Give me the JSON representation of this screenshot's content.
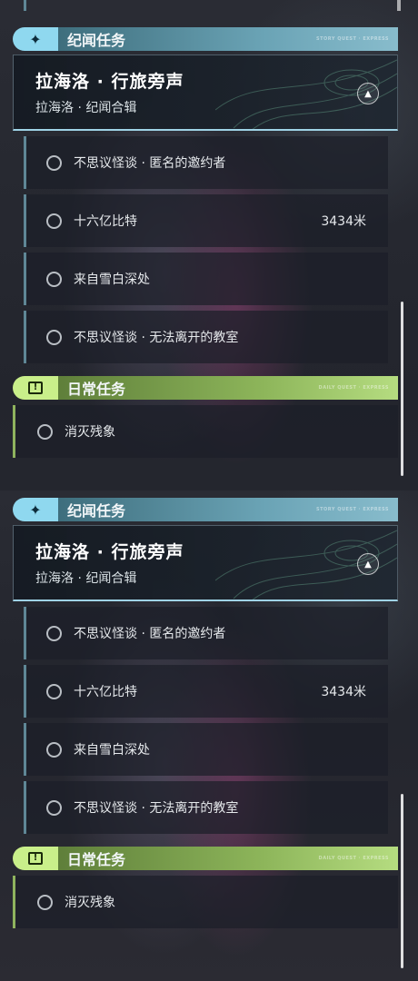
{
  "story_category": {
    "label": "纪闻任务",
    "badge_icon": "sparkle-icon",
    "tiny_text": "STORY QUEST · EXPRESS"
  },
  "chapter": {
    "title": "拉海洛 · 行旅旁声",
    "subtitle": "拉海洛 · 纪闻合辑",
    "collapse_icon": "chevron-up-icon"
  },
  "quests": [
    {
      "name": "不思议怪谈 · 匿名的邀约者",
      "distance": ""
    },
    {
      "name": "十六亿比特",
      "distance": "3434米"
    },
    {
      "name": "来自雪白深处",
      "distance": ""
    },
    {
      "name": "不思议怪谈 · 无法离开的教室",
      "distance": ""
    }
  ],
  "daily_category": {
    "label": "日常任务",
    "badge_icon": "alert-box-icon",
    "badge_glyph": "!",
    "tiny_text": "DAILY QUEST · EXPRESS"
  },
  "daily_quests": [
    {
      "name": "消灭残象"
    }
  ],
  "colors": {
    "story_accent": "#8fd8ef",
    "daily_accent": "#c9ef8a"
  }
}
